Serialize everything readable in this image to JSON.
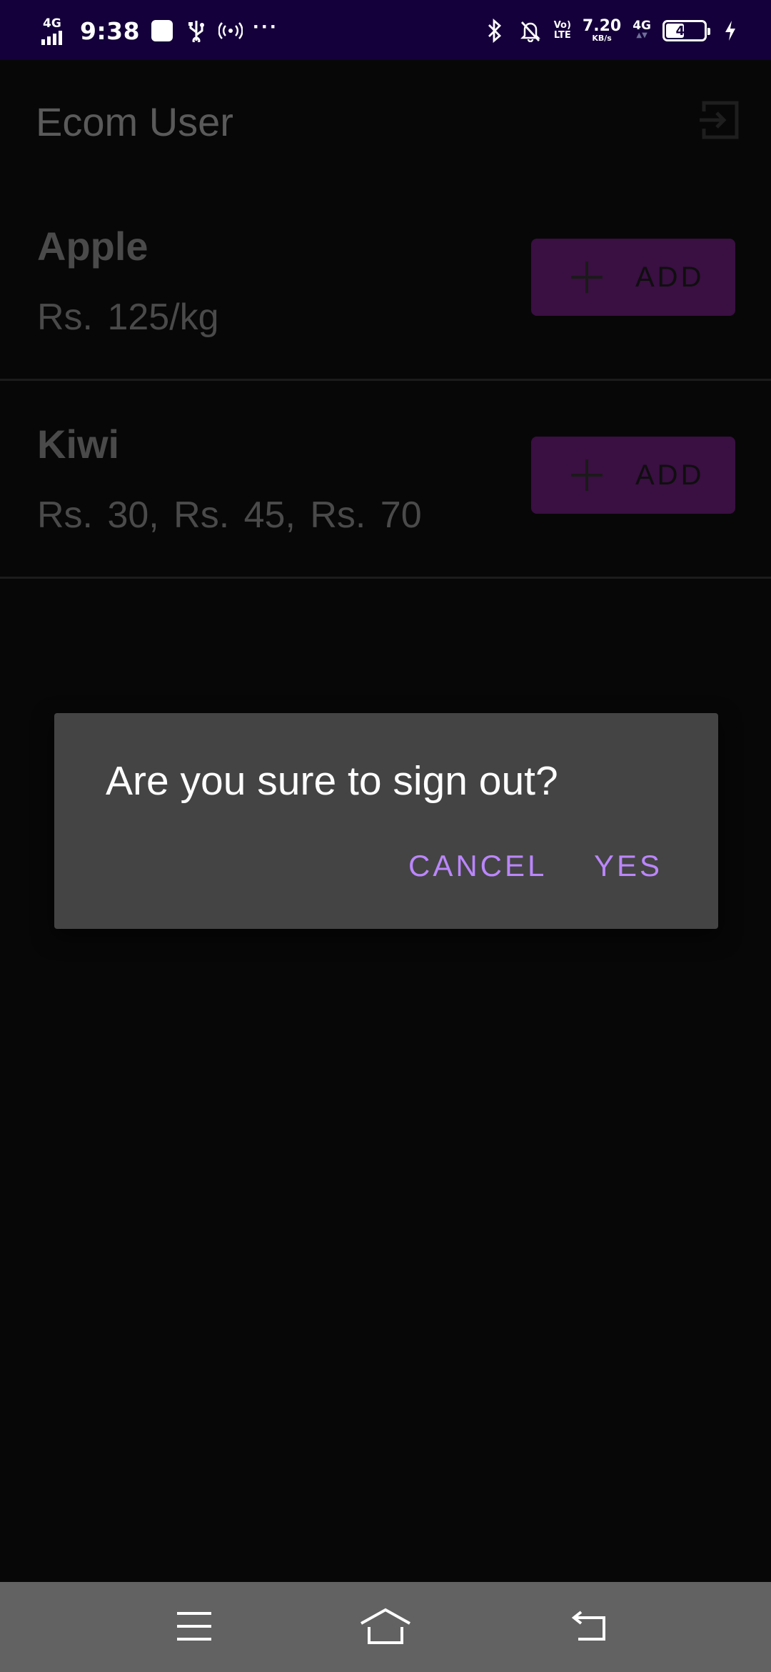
{
  "status_bar": {
    "network_label": "4G",
    "time": "9:38",
    "overflow": "···",
    "volte_top": "Vo)",
    "volte_bottom": "LTE",
    "speed_value": "7.20",
    "speed_unit": "KB/s",
    "network_right": "4G",
    "battery_level": 48,
    "battery_text": "48"
  },
  "app_bar": {
    "title": "Ecom User",
    "logout_icon": "logout-icon"
  },
  "products": [
    {
      "name": "Apple",
      "price": "Rs. 125/kg",
      "add_label": "ADD"
    },
    {
      "name": "Kiwi",
      "price": "Rs. 30,  Rs. 45,  Rs. 70",
      "add_label": "ADD"
    }
  ],
  "dialog": {
    "message": "Are you sure to sign out?",
    "cancel_label": "CANCEL",
    "confirm_label": "YES"
  },
  "colors": {
    "status_bar_bg": "#14003a",
    "accent": "#bb86fc",
    "add_button_bg": "#3a0f42",
    "dialog_bg": "#444444",
    "nav_bar_bg": "#626262"
  },
  "nav_bar": {
    "icons": [
      "menu-icon",
      "home-icon",
      "back-icon"
    ]
  }
}
